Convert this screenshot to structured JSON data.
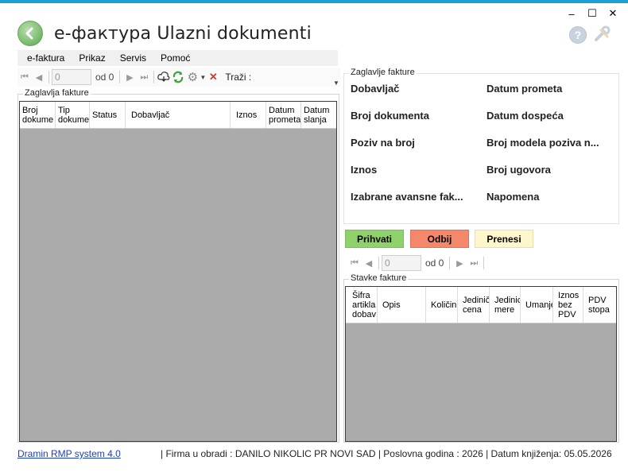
{
  "window": {
    "title": "e-фактура Ulazni dokumenti"
  },
  "menu": [
    "e-faktura",
    "Prikaz",
    "Servis",
    "Pomoć"
  ],
  "toolbar": {
    "page_value": "0",
    "page_of": "od 0",
    "search_label": "Traži :"
  },
  "left_panel": {
    "group_title": "Zaglavlja fakture",
    "columns": [
      "Broj\ndokume",
      "Tip\ndokume",
      "Status",
      "Dobavljač",
      "Iznos",
      "Datum\nprometa",
      "Datum\nslanja"
    ]
  },
  "detail": {
    "group_title": "Zaglavlje fakture",
    "fields_left": [
      "Dobavljač",
      "Broj dokumenta",
      "Poziv na broj",
      "Iznos",
      "Izabrane avansne fak..."
    ],
    "fields_right": [
      "Datum prometa",
      "Datum dospeća",
      "Broj modela poziva n...",
      "Broj ugovora",
      "Napomena"
    ]
  },
  "actions": {
    "accept": "Prihvati",
    "reject": "Odbij",
    "transfer": "Prenesi",
    "accept_color": "#8fd16a",
    "reject_color": "#f5876a",
    "transfer_color": "#fff7cc"
  },
  "items_toolbar": {
    "page_value": "0",
    "page_of": "od 0"
  },
  "items_panel": {
    "group_title": "Stavke fakture",
    "columns": [
      "Šifra\nartikla\ndobav",
      "Opis",
      "Količin",
      "Jedinič\ncena",
      "Jedinic\nmere",
      "Umanje",
      "Iznos\nbez\nPDV",
      "PDV\nstopa"
    ]
  },
  "status": {
    "link": "Dramin RMP system 4.0",
    "info": "|  Firma u obradi : DANILO NIKOLIC PR NOVI SAD  |  Poslovna godina : 2026  |  Datum knjiženja: 05.05.2026"
  }
}
